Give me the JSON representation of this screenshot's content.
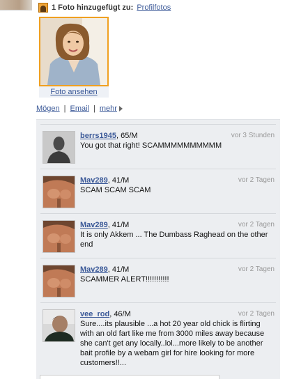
{
  "header": {
    "text": "1 Foto hinzugefügt zu:",
    "album_link": "Profilfotos"
  },
  "photo": {
    "caption": "Foto ansehen"
  },
  "actions": {
    "like": "Mögen",
    "email": "Email",
    "more": "mehr",
    "separator": "|"
  },
  "comments": [
    {
      "user": "berrs1945",
      "meta": ", 65/M",
      "time": "vor 3 Stunden",
      "text": "You got that right! SCAMMMMMMMMMM"
    },
    {
      "user": "Mav289",
      "meta": ", 41/M",
      "time": "vor 2 Tagen",
      "text": "SCAM SCAM SCAM"
    },
    {
      "user": "Mav289",
      "meta": ", 41/M",
      "time": "vor 2 Tagen",
      "text": "It is only Akkem ... The Dumbass Raghead on the other end"
    },
    {
      "user": "Mav289",
      "meta": ", 41/M",
      "time": "vor 2 Tagen",
      "text": "SCAMMER ALERT!!!!!!!!!!!"
    },
    {
      "user": "vee_rod",
      "meta": ", 46/M",
      "time": "vor 2 Tagen",
      "text": "Sure....its plausible ...a hot 20 year old chick is flirting with an old fart like me from 3000 miles away because she can't get any locally..lol...more likely to be another bait profile by a webam girl for hire looking for more customers!!..."
    }
  ]
}
